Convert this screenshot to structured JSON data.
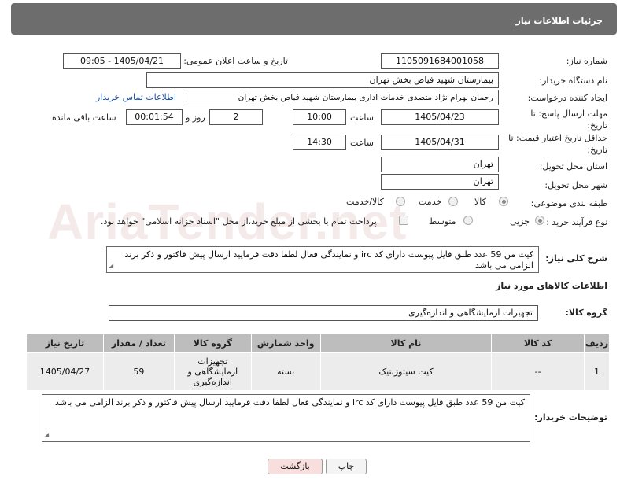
{
  "header": {
    "title": "جزئیات اطلاعات نیاز"
  },
  "watermark": "AriaTender.net",
  "form": {
    "need_number_label": "شماره نیاز:",
    "need_number": "1105091684001058",
    "announce_label": "تاریخ و ساعت اعلان عمومی:",
    "announce_value": "1405/04/21 - 09:05",
    "buyer_org_label": "نام دستگاه خریدار:",
    "buyer_org": "بیمارستان شهید فیاض بخش تهران",
    "creator_label": "ایجاد کننده درخواست:",
    "creator": "رحمان بهرام نژاد متصدی خدمات اداری بیمارستان شهید فیاض بخش تهران",
    "contact_link": "اطلاعات تماس خریدار",
    "reply_deadline_label": "مهلت ارسال پاسخ: تا تاریخ:",
    "reply_date": "1405/04/23",
    "time_label": "ساعت",
    "reply_time": "10:00",
    "days_value": "2",
    "days_label": "روز و",
    "remaining_value": "00:01:54",
    "remaining_label": "ساعت باقی مانده",
    "price_deadline_label": "حداقل تاریخ اعتبار قیمت: تا تاریخ:",
    "price_date": "1405/04/31",
    "price_time": "14:30",
    "province_label": "استان محل تحویل:",
    "province": "تهران",
    "city_label": "شهر محل تحویل:",
    "city": "تهران",
    "category_label": "طبقه بندی موضوعی:",
    "category_options": [
      "کالا",
      "خدمت",
      "کالا/خدمت"
    ],
    "process_label": "نوع فرآیند خرید :",
    "process_options": [
      "جزیی",
      "متوسط"
    ],
    "payment_note": "پرداخت تمام یا بخشی از مبلغ خرید،از محل \"اسناد خزانه اسلامی\" خواهد بود."
  },
  "description": {
    "label": "شرح کلی نیاز:",
    "text": "کیت من  59  عدد طبق فایل پیوست  دارای کد irc و نمایندگی فعال لطفا دقت فرمایید ارسال پیش فاکتور و ذکر برند الزامی می باشد"
  },
  "goods_info_title": "اطلاعات کالاهای مورد نیاز",
  "goods_group": {
    "label": "گروه کالا:",
    "value": "تجهیزات آزمایشگاهی و اندازه‌گیری"
  },
  "table": {
    "headers": [
      "ردیف",
      "کد کالا",
      "نام کالا",
      "واحد شمارش",
      "گروه کالا",
      "تعداد / مقدار",
      "تاریخ نیاز"
    ],
    "rows": [
      {
        "row": "1",
        "code": "--",
        "name": "کیت سیتوژنتیک",
        "unit": "بسته",
        "group": "تجهیزات آزمایشگاهی و اندازه‌گیری",
        "qty": "59",
        "date": "1405/04/27"
      }
    ]
  },
  "buyer_notes": {
    "label": "توضیحات خریدار:",
    "text": "کیت من  59  عدد طبق فایل پیوست  دارای کد irc و نمایندگی فعال لطفا دقت فرمایید ارسال پیش فاکتور و ذکر برند الزامی می باشد"
  },
  "buttons": {
    "print": "چاپ",
    "back": "بازگشت"
  },
  "colors": {
    "header_bg": "#6d6d6d",
    "link": "#1a4fa0",
    "table_header": "#bdbdbd",
    "back_button": "#f9dede"
  }
}
